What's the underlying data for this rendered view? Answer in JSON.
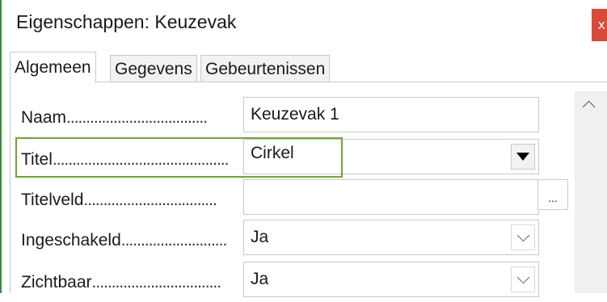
{
  "window": {
    "title": "Eigenschappen: Keuzevak",
    "close_label": "x"
  },
  "tabs": [
    {
      "label": "Algemeen",
      "active": true
    },
    {
      "label": "Gegevens",
      "active": false
    },
    {
      "label": "Gebeurtenissen",
      "active": false
    }
  ],
  "properties": [
    {
      "label": "Naam",
      "dots": "....................................",
      "value": "Keuzevak 1",
      "control": "text"
    },
    {
      "label": "Titel",
      "dots": ".............................................",
      "value": "Cirkel",
      "control": "combo-dropdown"
    },
    {
      "label": "Titelveld",
      "dots": "..................................",
      "value": "",
      "control": "text-with-browse",
      "button_label": "..."
    },
    {
      "label": "Ingeschakeld",
      "dots": "...........................",
      "value": "Ja",
      "control": "select"
    },
    {
      "label": "Zichtbaar",
      "dots": ".................................",
      "value": "Ja",
      "control": "select"
    }
  ],
  "colors": {
    "accent_highlight": "#6aaa2c",
    "close_button": "#d94a3a"
  },
  "icons": {
    "dropdown_arrow": "triangle-down",
    "select_arrow": "chevron-down",
    "scroll_up": "chevron-up"
  }
}
